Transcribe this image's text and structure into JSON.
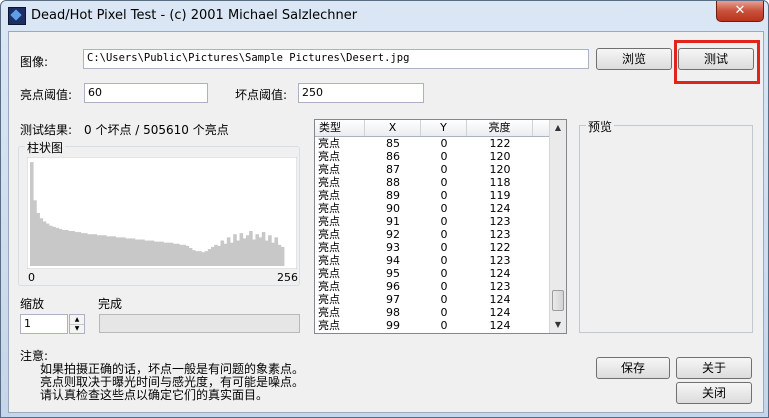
{
  "window": {
    "title": "Dead/Hot Pixel Test - (c) 2001 Michael Salzlechner",
    "close_label": "✕"
  },
  "form": {
    "image_label": "图像:",
    "image_path": "C:\\Users\\Public\\Pictures\\Sample Pictures\\Desert.jpg",
    "browse_label": "浏览",
    "test_label": "测试",
    "bright_threshold_label": "亮点阈值:",
    "bright_threshold_value": "60",
    "dead_threshold_label": "坏点阈值:",
    "dead_threshold_value": "250",
    "result_label": "测试结果:",
    "result_value": "0 个坏点 / 505610 个亮点"
  },
  "histogram": {
    "title": "柱状图",
    "min_label": "0",
    "max_label": "256",
    "profile": [
      0.98,
      0.62,
      0.5,
      0.45,
      0.42,
      0.4,
      0.38,
      0.37,
      0.36,
      0.35,
      0.34,
      0.34,
      0.33,
      0.33,
      0.32,
      0.32,
      0.31,
      0.31,
      0.3,
      0.3,
      0.3,
      0.29,
      0.29,
      0.29,
      0.28,
      0.28,
      0.28,
      0.27,
      0.27,
      0.27,
      0.26,
      0.26,
      0.26,
      0.25,
      0.25,
      0.25,
      0.24,
      0.24,
      0.24,
      0.23,
      0.23,
      0.23,
      0.22,
      0.22,
      0.22,
      0.21,
      0.21,
      0.2,
      0.2,
      0.19,
      0.17,
      0.15,
      0.14,
      0.14,
      0.13,
      0.14,
      0.16,
      0.18,
      0.2,
      0.19,
      0.24,
      0.21,
      0.27,
      0.22,
      0.3,
      0.24,
      0.31,
      0.26,
      0.29,
      0.33,
      0.25,
      0.3,
      0.27,
      0.32,
      0.24,
      0.29,
      0.22,
      0.27,
      0.2,
      0.18
    ]
  },
  "zoom": {
    "label": "缩放",
    "value": "1"
  },
  "progress": {
    "label": "完成",
    "percent": 0
  },
  "table": {
    "headers": [
      "类型",
      "X",
      "Y",
      "亮度"
    ],
    "rows": [
      [
        "亮点",
        "85",
        "0",
        "122"
      ],
      [
        "亮点",
        "86",
        "0",
        "120"
      ],
      [
        "亮点",
        "87",
        "0",
        "120"
      ],
      [
        "亮点",
        "88",
        "0",
        "118"
      ],
      [
        "亮点",
        "89",
        "0",
        "119"
      ],
      [
        "亮点",
        "90",
        "0",
        "124"
      ],
      [
        "亮点",
        "91",
        "0",
        "123"
      ],
      [
        "亮点",
        "92",
        "0",
        "123"
      ],
      [
        "亮点",
        "93",
        "0",
        "122"
      ],
      [
        "亮点",
        "94",
        "0",
        "123"
      ],
      [
        "亮点",
        "95",
        "0",
        "124"
      ],
      [
        "亮点",
        "96",
        "0",
        "123"
      ],
      [
        "亮点",
        "97",
        "0",
        "124"
      ],
      [
        "亮点",
        "98",
        "0",
        "124"
      ],
      [
        "亮点",
        "99",
        "0",
        "124"
      ]
    ]
  },
  "preview": {
    "title": "预览"
  },
  "notes": {
    "title": "注意:",
    "lines": [
      "如果拍摄正确的话，坏点一般是有问题的象素点。",
      "亮点则取决于曝光时间与感光度，有可能是噪点。",
      "请认真检查这些点以确定它们的真实面目。"
    ]
  },
  "buttons": {
    "save_label": "保存",
    "about_label": "关于",
    "close_label": "关闭"
  },
  "colors": {
    "highlight": "#e0241a"
  }
}
